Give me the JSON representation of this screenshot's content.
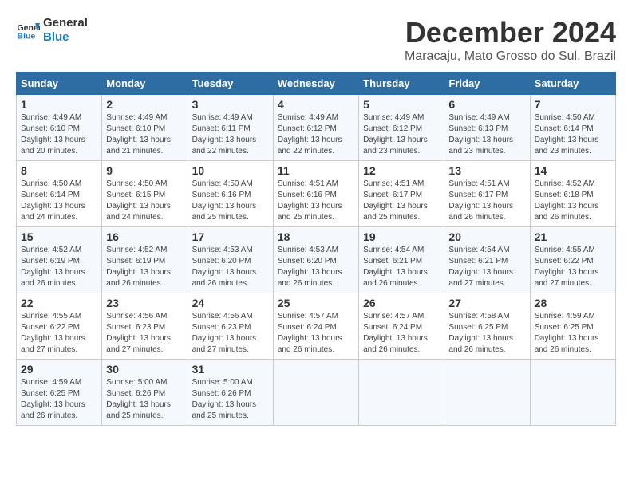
{
  "header": {
    "logo_line1": "General",
    "logo_line2": "Blue",
    "title": "December 2024",
    "subtitle": "Maracaju, Mato Grosso do Sul, Brazil"
  },
  "weekdays": [
    "Sunday",
    "Monday",
    "Tuesday",
    "Wednesday",
    "Thursday",
    "Friday",
    "Saturday"
  ],
  "weeks": [
    [
      {
        "day": "1",
        "sunrise": "Sunrise: 4:49 AM",
        "sunset": "Sunset: 6:10 PM",
        "daylight": "Daylight: 13 hours and 20 minutes."
      },
      {
        "day": "2",
        "sunrise": "Sunrise: 4:49 AM",
        "sunset": "Sunset: 6:10 PM",
        "daylight": "Daylight: 13 hours and 21 minutes."
      },
      {
        "day": "3",
        "sunrise": "Sunrise: 4:49 AM",
        "sunset": "Sunset: 6:11 PM",
        "daylight": "Daylight: 13 hours and 22 minutes."
      },
      {
        "day": "4",
        "sunrise": "Sunrise: 4:49 AM",
        "sunset": "Sunset: 6:12 PM",
        "daylight": "Daylight: 13 hours and 22 minutes."
      },
      {
        "day": "5",
        "sunrise": "Sunrise: 4:49 AM",
        "sunset": "Sunset: 6:12 PM",
        "daylight": "Daylight: 13 hours and 23 minutes."
      },
      {
        "day": "6",
        "sunrise": "Sunrise: 4:49 AM",
        "sunset": "Sunset: 6:13 PM",
        "daylight": "Daylight: 13 hours and 23 minutes."
      },
      {
        "day": "7",
        "sunrise": "Sunrise: 4:50 AM",
        "sunset": "Sunset: 6:14 PM",
        "daylight": "Daylight: 13 hours and 23 minutes."
      }
    ],
    [
      {
        "day": "8",
        "sunrise": "Sunrise: 4:50 AM",
        "sunset": "Sunset: 6:14 PM",
        "daylight": "Daylight: 13 hours and 24 minutes."
      },
      {
        "day": "9",
        "sunrise": "Sunrise: 4:50 AM",
        "sunset": "Sunset: 6:15 PM",
        "daylight": "Daylight: 13 hours and 24 minutes."
      },
      {
        "day": "10",
        "sunrise": "Sunrise: 4:50 AM",
        "sunset": "Sunset: 6:16 PM",
        "daylight": "Daylight: 13 hours and 25 minutes."
      },
      {
        "day": "11",
        "sunrise": "Sunrise: 4:51 AM",
        "sunset": "Sunset: 6:16 PM",
        "daylight": "Daylight: 13 hours and 25 minutes."
      },
      {
        "day": "12",
        "sunrise": "Sunrise: 4:51 AM",
        "sunset": "Sunset: 6:17 PM",
        "daylight": "Daylight: 13 hours and 25 minutes."
      },
      {
        "day": "13",
        "sunrise": "Sunrise: 4:51 AM",
        "sunset": "Sunset: 6:17 PM",
        "daylight": "Daylight: 13 hours and 26 minutes."
      },
      {
        "day": "14",
        "sunrise": "Sunrise: 4:52 AM",
        "sunset": "Sunset: 6:18 PM",
        "daylight": "Daylight: 13 hours and 26 minutes."
      }
    ],
    [
      {
        "day": "15",
        "sunrise": "Sunrise: 4:52 AM",
        "sunset": "Sunset: 6:19 PM",
        "daylight": "Daylight: 13 hours and 26 minutes."
      },
      {
        "day": "16",
        "sunrise": "Sunrise: 4:52 AM",
        "sunset": "Sunset: 6:19 PM",
        "daylight": "Daylight: 13 hours and 26 minutes."
      },
      {
        "day": "17",
        "sunrise": "Sunrise: 4:53 AM",
        "sunset": "Sunset: 6:20 PM",
        "daylight": "Daylight: 13 hours and 26 minutes."
      },
      {
        "day": "18",
        "sunrise": "Sunrise: 4:53 AM",
        "sunset": "Sunset: 6:20 PM",
        "daylight": "Daylight: 13 hours and 26 minutes."
      },
      {
        "day": "19",
        "sunrise": "Sunrise: 4:54 AM",
        "sunset": "Sunset: 6:21 PM",
        "daylight": "Daylight: 13 hours and 26 minutes."
      },
      {
        "day": "20",
        "sunrise": "Sunrise: 4:54 AM",
        "sunset": "Sunset: 6:21 PM",
        "daylight": "Daylight: 13 hours and 27 minutes."
      },
      {
        "day": "21",
        "sunrise": "Sunrise: 4:55 AM",
        "sunset": "Sunset: 6:22 PM",
        "daylight": "Daylight: 13 hours and 27 minutes."
      }
    ],
    [
      {
        "day": "22",
        "sunrise": "Sunrise: 4:55 AM",
        "sunset": "Sunset: 6:22 PM",
        "daylight": "Daylight: 13 hours and 27 minutes."
      },
      {
        "day": "23",
        "sunrise": "Sunrise: 4:56 AM",
        "sunset": "Sunset: 6:23 PM",
        "daylight": "Daylight: 13 hours and 27 minutes."
      },
      {
        "day": "24",
        "sunrise": "Sunrise: 4:56 AM",
        "sunset": "Sunset: 6:23 PM",
        "daylight": "Daylight: 13 hours and 27 minutes."
      },
      {
        "day": "25",
        "sunrise": "Sunrise: 4:57 AM",
        "sunset": "Sunset: 6:24 PM",
        "daylight": "Daylight: 13 hours and 26 minutes."
      },
      {
        "day": "26",
        "sunrise": "Sunrise: 4:57 AM",
        "sunset": "Sunset: 6:24 PM",
        "daylight": "Daylight: 13 hours and 26 minutes."
      },
      {
        "day": "27",
        "sunrise": "Sunrise: 4:58 AM",
        "sunset": "Sunset: 6:25 PM",
        "daylight": "Daylight: 13 hours and 26 minutes."
      },
      {
        "day": "28",
        "sunrise": "Sunrise: 4:59 AM",
        "sunset": "Sunset: 6:25 PM",
        "daylight": "Daylight: 13 hours and 26 minutes."
      }
    ],
    [
      {
        "day": "29",
        "sunrise": "Sunrise: 4:59 AM",
        "sunset": "Sunset: 6:25 PM",
        "daylight": "Daylight: 13 hours and 26 minutes."
      },
      {
        "day": "30",
        "sunrise": "Sunrise: 5:00 AM",
        "sunset": "Sunset: 6:26 PM",
        "daylight": "Daylight: 13 hours and 25 minutes."
      },
      {
        "day": "31",
        "sunrise": "Sunrise: 5:00 AM",
        "sunset": "Sunset: 6:26 PM",
        "daylight": "Daylight: 13 hours and 25 minutes."
      },
      null,
      null,
      null,
      null
    ]
  ]
}
